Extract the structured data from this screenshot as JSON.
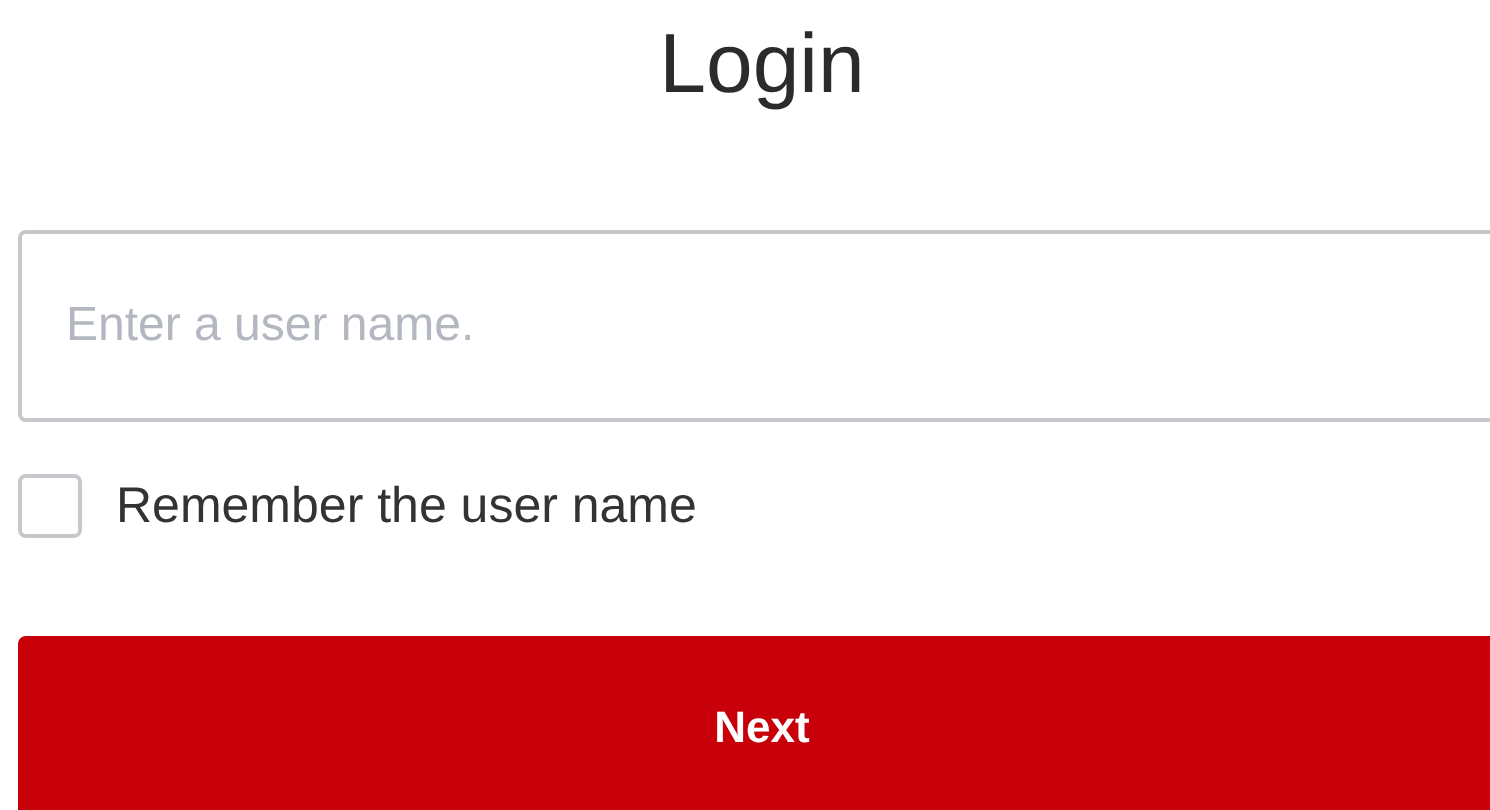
{
  "title": "Login",
  "username_field": {
    "placeholder": "Enter a user name."
  },
  "remember_checkbox": {
    "label": "Remember the user name",
    "checked": false
  },
  "buttons": [
    "Next"
  ]
}
